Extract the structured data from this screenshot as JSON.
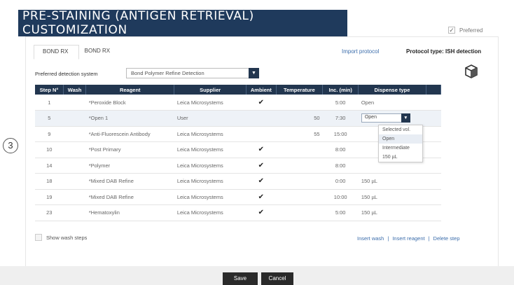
{
  "banner": {
    "title": "PRE-STAINING (ANTIGEN RETRIEVAL) CUSTOMIZATION"
  },
  "header": {
    "preferred_label": "Preferred",
    "preferred_check": "✓",
    "tabs": [
      "BOND RX ",
      "BOND RX"
    ],
    "import_link": "Import protocol",
    "protocol_type_label": "Protocol type:",
    "protocol_type_value": "ISH detection"
  },
  "detection": {
    "label": "Preferred detection system",
    "value": "Bond Polymer Refine Detection"
  },
  "table": {
    "headers": [
      "Step N°",
      "Wash",
      "Reagent",
      "Supplier",
      "Ambient",
      "Temperature",
      "Inc. (min)",
      "Dispense type"
    ],
    "rows": [
      {
        "step": "1",
        "reagent": "*Peroxide Block",
        "supplier": "Leica Microsystems",
        "ambient": "✔",
        "temperature": "",
        "inc": "5:00",
        "dispense": "Open"
      },
      {
        "step": "5",
        "reagent": "*Open 1",
        "supplier": "User",
        "ambient": "",
        "temperature": "50",
        "inc": "7:30",
        "dispense": "Open"
      },
      {
        "step": "9",
        "reagent": "*Anti-Fluorescein Antibody",
        "supplier": "Leica Microsystems",
        "ambient": "",
        "temperature": "55",
        "inc": "15:00",
        "dispense": ""
      },
      {
        "step": "10",
        "reagent": "*Post Primary",
        "supplier": "Leica Microsystems",
        "ambient": "✔",
        "temperature": "",
        "inc": "8:00",
        "dispense": ""
      },
      {
        "step": "14",
        "reagent": "*Polymer",
        "supplier": "Leica Microsystems",
        "ambient": "✔",
        "temperature": "",
        "inc": "8:00",
        "dispense": ""
      },
      {
        "step": "18",
        "reagent": "*Mixed DAB Refine",
        "supplier": "Leica Microsystems",
        "ambient": "✔",
        "temperature": "",
        "inc": "0:00",
        "dispense": "150 µL"
      },
      {
        "step": "19",
        "reagent": "*Mixed DAB Refine",
        "supplier": "Leica Microsystems",
        "ambient": "✔",
        "temperature": "",
        "inc": "10:00",
        "dispense": "150 µL"
      },
      {
        "step": "23",
        "reagent": "*Hematoxylin",
        "supplier": "Leica Microsystems",
        "ambient": "✔",
        "temperature": "",
        "inc": "5:00",
        "dispense": "150 µL"
      }
    ]
  },
  "dropdown": {
    "options": [
      "Selected vol.",
      "Open",
      "Intermediate",
      "150 µL"
    ]
  },
  "callout": {
    "number": "3"
  },
  "bottom": {
    "show_wash": "Show wash steps",
    "insert_wash": "Insert wash",
    "insert_reagent": "Insert reagent",
    "delete_step": "Delete step",
    "separator": "|"
  },
  "footer": {
    "save": "Save",
    "cancel": "Cancel"
  },
  "colors": {
    "banner": "#1f3a5c",
    "table_header": "#22364f",
    "link": "#3b6dab"
  },
  "icons": [
    "check-icon",
    "chevron-down-icon",
    "cube-icon"
  ]
}
